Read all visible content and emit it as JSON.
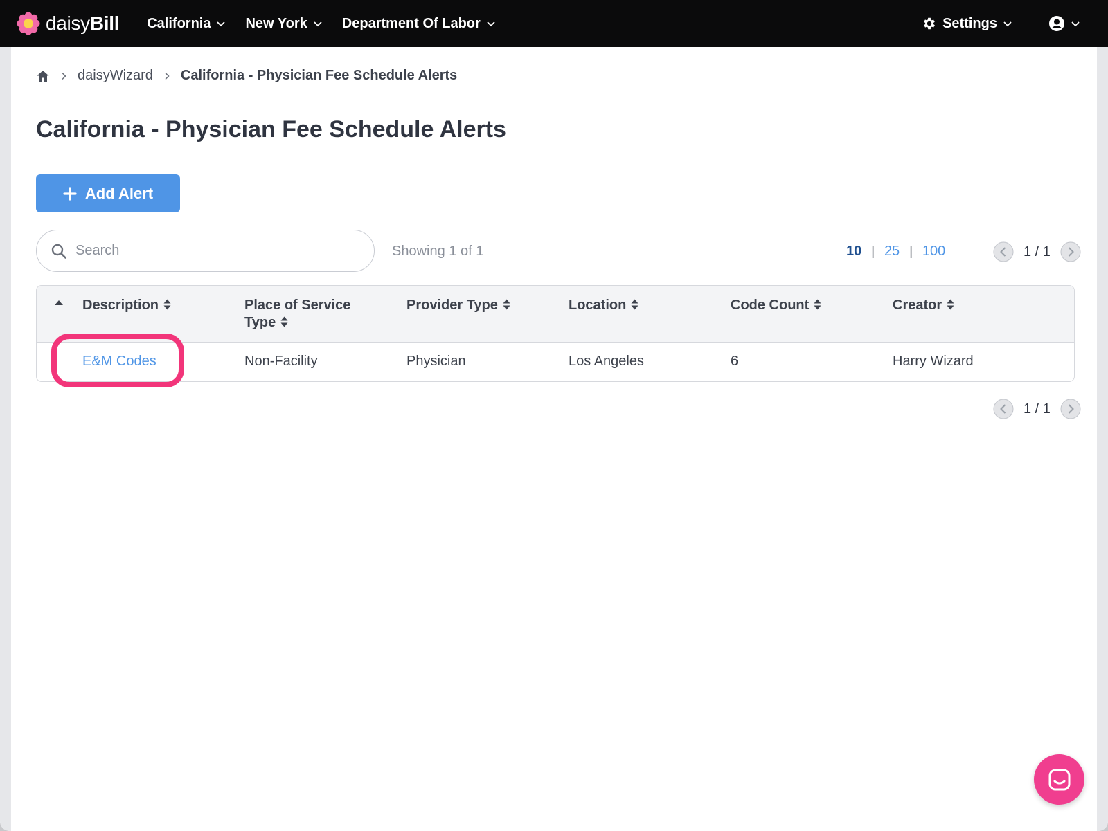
{
  "brand": {
    "name_light": "daisy",
    "name_bold": "Bill"
  },
  "nav": {
    "items": [
      {
        "label": "California"
      },
      {
        "label": "New York"
      },
      {
        "label": "Department Of Labor"
      }
    ],
    "settings_label": "Settings"
  },
  "breadcrumb": {
    "items": [
      {
        "label": "daisyWizard"
      },
      {
        "label": "California - Physician Fee Schedule Alerts"
      }
    ]
  },
  "page": {
    "title": "California - Physician Fee Schedule Alerts",
    "add_button_label": "Add Alert"
  },
  "search": {
    "placeholder": "Search",
    "value": ""
  },
  "showing_text": "Showing 1 of 1",
  "page_size": {
    "options": [
      "10",
      "25",
      "100"
    ],
    "selected": "10",
    "separator": "|"
  },
  "pagination": {
    "text": "1 / 1"
  },
  "table": {
    "columns": [
      {
        "label": "Description"
      },
      {
        "label": "Place of Service Type"
      },
      {
        "label": "Provider Type"
      },
      {
        "label": "Location"
      },
      {
        "label": "Code Count"
      },
      {
        "label": "Creator"
      }
    ],
    "rows": [
      {
        "description": "E&M Codes",
        "place_of_service_type": "Non-Facility",
        "provider_type": "Physician",
        "location": "Los Angeles",
        "code_count": "6",
        "creator": "Harry Wizard"
      }
    ]
  },
  "colors": {
    "topbar": "#0b0b0c",
    "accent_blue": "#4f95e6",
    "highlight_pink": "#f2357a",
    "chat_pink": "#f03e8f"
  },
  "icons": {
    "logo": "daisy-flower-icon",
    "home": "home-icon",
    "settings": "gear-icon",
    "user": "user-circle-icon",
    "search": "search-icon",
    "add": "plus-icon",
    "sort": "sort-icon",
    "chat": "chat-icon"
  }
}
